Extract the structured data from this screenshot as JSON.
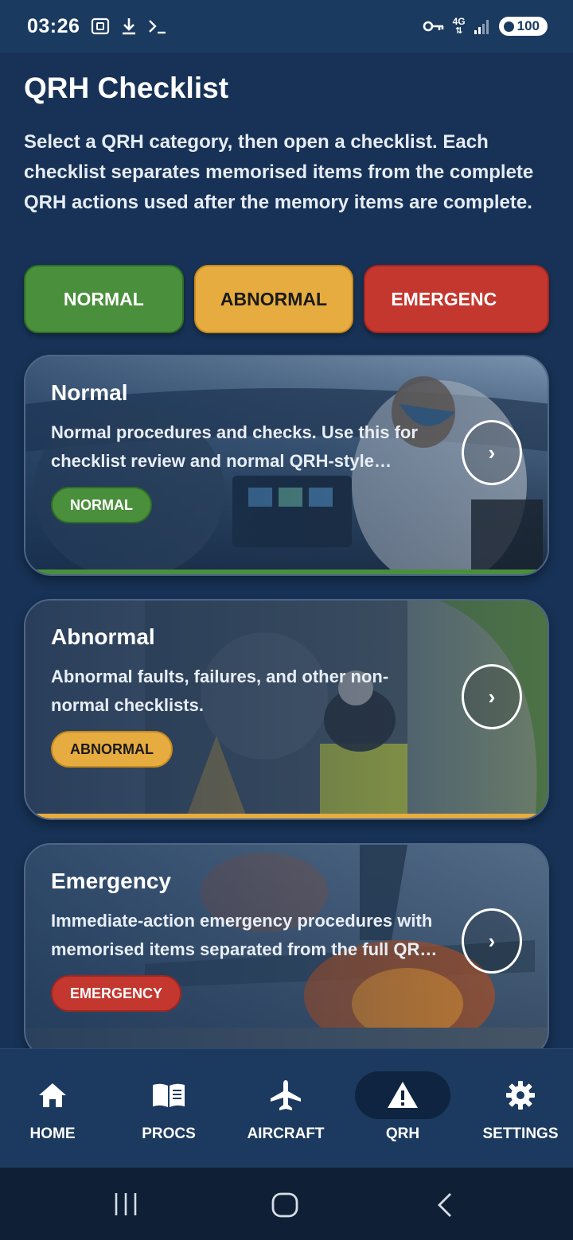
{
  "status_bar": {
    "time": "03:26",
    "network": "4G",
    "battery": "100",
    "icons": [
      "screenshot-icon",
      "download-icon",
      "terminal-icon",
      "vpn-key-icon",
      "signal-icon"
    ]
  },
  "header": {
    "title": "QRH Checklist",
    "subtitle": "Select a QRH category, then open a checklist. Each checklist separates memorised items from the complete QRH actions used after the memory items are complete."
  },
  "categories": [
    {
      "label": "NORMAL",
      "color": "#4a8f3c"
    },
    {
      "label": "ABNORMAL",
      "color": "#e7ac3f"
    },
    {
      "label": "EMERGENC",
      "color": "#c4372f"
    }
  ],
  "cards": [
    {
      "title": "Normal",
      "description": "Normal procedures and checks. Use this for checklist review and normal QRH-style reference.",
      "badge": "NORMAL",
      "chevron": "›",
      "accent": "#4a8f3c"
    },
    {
      "title": "Abnormal",
      "description": "Abnormal faults, failures, and other non-normal checklists.",
      "badge": "ABNORMAL",
      "chevron": "›",
      "accent": "#e7ac3f"
    },
    {
      "title": "Emergency",
      "description": "Immediate-action emergency procedures with memorised items separated from the full QRH actions.",
      "badge": "EMERGENCY",
      "chevron": "›",
      "accent": "#c4372f"
    }
  ],
  "bottom_nav": [
    {
      "label": "HOME",
      "icon": "home-icon",
      "active": false
    },
    {
      "label": "PROCS",
      "icon": "book-icon",
      "active": false
    },
    {
      "label": "AIRCRAFT",
      "icon": "airplane-icon",
      "active": false
    },
    {
      "label": "QRH",
      "icon": "warning-icon",
      "active": true
    },
    {
      "label": "SETTINGS",
      "icon": "gear-icon",
      "active": false
    }
  ],
  "system_nav": [
    "recents-icon",
    "home-circle-icon",
    "back-icon"
  ]
}
